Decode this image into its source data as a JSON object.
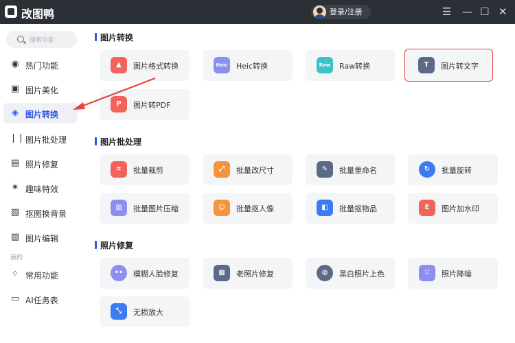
{
  "app": {
    "title": "改图鸭",
    "login_label": "登录/注册"
  },
  "sidebar": {
    "search_placeholder": "搜索功能",
    "items": [
      {
        "label": "热门功能",
        "icon": "flame-icon"
      },
      {
        "label": "图片美化",
        "icon": "image-icon"
      },
      {
        "label": "图片转换",
        "icon": "convert-icon",
        "active": true
      },
      {
        "label": "图片批处理",
        "icon": "layers-icon"
      },
      {
        "label": "照片修复",
        "icon": "repair-icon"
      },
      {
        "label": "趣味特效",
        "icon": "sparkle-icon"
      },
      {
        "label": "抠图换背景",
        "icon": "cutout-icon"
      },
      {
        "label": "图片编辑",
        "icon": "edit-image-icon"
      }
    ],
    "group_caption": "我的",
    "my_items": [
      {
        "label": "常用功能",
        "icon": "grid-icon"
      },
      {
        "label": "AI任务表",
        "icon": "tasklist-icon"
      }
    ]
  },
  "sections": [
    {
      "title": "图片转换",
      "cards": [
        {
          "label": "图片格式转换",
          "icon": "format-icon",
          "color": "#f2635b"
        },
        {
          "label": "Heic转换",
          "icon": "heic-icon",
          "color": "#8b8ff0",
          "badge": "Heic"
        },
        {
          "label": "Raw转换",
          "icon": "raw-icon",
          "color": "#3cc3c8",
          "badge": "Raw"
        },
        {
          "label": "图片转文字",
          "icon": "image-to-text-icon",
          "color": "#5b6b87",
          "highlighted": true
        },
        {
          "label": "图片转PDF",
          "icon": "pdf-icon",
          "color": "#f2635b"
        }
      ]
    },
    {
      "title": "图片批处理",
      "cards": [
        {
          "label": "批量裁剪",
          "icon": "crop-icon",
          "color": "#f2635b"
        },
        {
          "label": "批量改尺寸",
          "icon": "resize-icon",
          "color": "#f5943c"
        },
        {
          "label": "批量重命名",
          "icon": "rename-icon",
          "color": "#5b6b87"
        },
        {
          "label": "批量旋转",
          "icon": "rotate-icon",
          "color": "#3c7bf2"
        },
        {
          "label": "批量图片压缩",
          "icon": "compress-icon",
          "color": "#8b8ff0"
        },
        {
          "label": "批量抠人像",
          "icon": "portrait-cutout-icon",
          "color": "#f5943c"
        },
        {
          "label": "批量抠物品",
          "icon": "object-cutout-icon",
          "color": "#3c7bf2"
        },
        {
          "label": "图片加水印",
          "icon": "watermark-icon",
          "color": "#f2635b"
        }
      ]
    },
    {
      "title": "照片修复",
      "cards": [
        {
          "label": "模糊人脸修复",
          "icon": "face-repair-icon",
          "color": "#8b8ff0"
        },
        {
          "label": "老照片修复",
          "icon": "old-photo-icon",
          "color": "#5b6b87"
        },
        {
          "label": "黑白照片上色",
          "icon": "palette-icon",
          "color": "#5b6b87"
        },
        {
          "label": "照片降噪",
          "icon": "denoise-icon",
          "color": "#8b8ff0"
        },
        {
          "label": "无损放大",
          "icon": "upscale-icon",
          "color": "#3c7bf2"
        }
      ]
    }
  ]
}
